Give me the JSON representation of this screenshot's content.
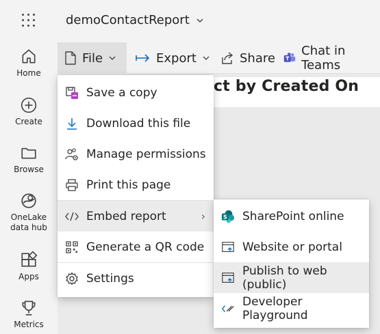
{
  "app": {
    "report_name": "demoContactReport",
    "chevron": "⌄"
  },
  "leftnav": {
    "items": [
      {
        "label": "Home",
        "icon": "home-icon"
      },
      {
        "label": "Create",
        "icon": "create-icon"
      },
      {
        "label": "Browse",
        "icon": "folder-icon"
      },
      {
        "label": "OneLake data hub",
        "icon": "onelake-icon"
      },
      {
        "label": "Apps",
        "icon": "apps-icon"
      },
      {
        "label": "Metrics",
        "icon": "trophy-icon"
      }
    ]
  },
  "toolbar": {
    "file": "File",
    "export": "Export",
    "share": "Share",
    "chat": "Chat in Teams"
  },
  "visual": {
    "title_fragment": "ct by Created On"
  },
  "file_menu": {
    "items": [
      {
        "label": "Save a copy",
        "icon": "save-copy-icon"
      },
      {
        "label": "Download this file",
        "icon": "download-icon"
      },
      {
        "label": "Manage permissions",
        "icon": "people-settings-icon"
      },
      {
        "label": "Print this page",
        "icon": "print-icon"
      },
      {
        "label": "Embed report",
        "icon": "code-icon"
      },
      {
        "label": "Generate a QR code",
        "icon": "qr-code-icon"
      },
      {
        "label": "Settings",
        "icon": "gear-icon"
      }
    ],
    "submenu_arrow": "›"
  },
  "embed_menu": {
    "items": [
      {
        "label": "SharePoint online",
        "icon": "sharepoint-icon"
      },
      {
        "label": "Website or portal",
        "icon": "website-icon"
      },
      {
        "label": "Publish to web (public)",
        "icon": "publish-icon"
      },
      {
        "label": "Developer Playground",
        "icon": "developer-icon"
      }
    ]
  },
  "colors": {
    "accent": "#0f6cbd",
    "nav_bg": "#f3f3f3",
    "highlight": "#ebebeb",
    "teams": "#5b5fc7",
    "sharepoint": "#036c70"
  }
}
